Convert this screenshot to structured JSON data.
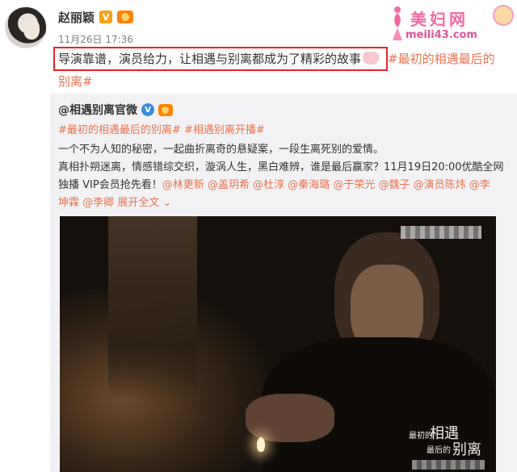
{
  "author": {
    "name": "赵丽颖",
    "verified_badge": "V",
    "member_badge_icon": "weibo-member-icon"
  },
  "timestamp": "11月26日 17:36",
  "post": {
    "text": "导演靠谱，演员给力，让相遇与别离都成为了精彩的故事",
    "emoji_icon": "pig-emoji-icon",
    "hashtag_part1": "#最初的相遇最后的",
    "hashtag_part2": "别离#"
  },
  "watermark": {
    "brand": "美妇网",
    "domain": "meili43.com"
  },
  "repost": {
    "author": "@相遇别离官微",
    "verified_badge": "V",
    "hashtags": [
      "#最初的相遇最后的别离#",
      "#相遇别离开播#"
    ],
    "line1": "一个不为人知的秘密，一起曲折离奇的悬疑案，一段生离死别的爱情。",
    "line2": "真相扑朔迷离，情感错综交织，漩涡人生，黑白难辨，谁是最后赢家？11月19日20:00优酷全网",
    "line3_prefix": "独播 VIP会员抢先看！",
    "mentions_line3": [
      "@林更新",
      "@盖玥希",
      "@杜淳",
      "@秦海璐",
      "@于荣光",
      "@魏子",
      "@演员陈炜",
      "@李"
    ],
    "mentions_line4": [
      "坤霖",
      "@李卿"
    ],
    "expand_label": "展开全文",
    "expand_icon": "chevron-down-icon"
  },
  "video": {
    "title_logo": [
      "最初的",
      "相遇",
      "最后的",
      "别离"
    ]
  },
  "colors": {
    "hashtag": "#eb7350",
    "highlight_border": "#e0252a",
    "repost_bg": "#f2f2f5"
  }
}
